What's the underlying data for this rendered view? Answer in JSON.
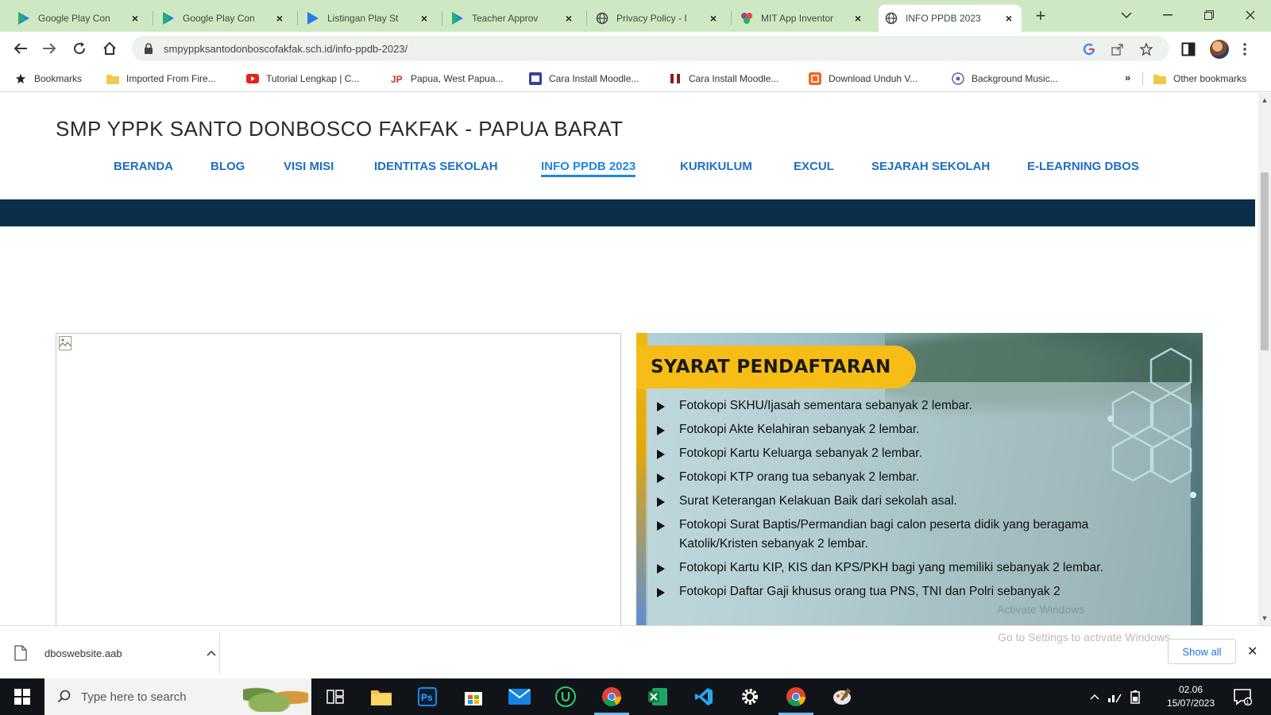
{
  "browser": {
    "tabs": [
      {
        "label": "Google Play Con",
        "icon": "google-play-icon",
        "active": false
      },
      {
        "label": "Google Play Con",
        "icon": "google-play-icon",
        "active": false
      },
      {
        "label": "Listingan Play St",
        "icon": "google-play-icon",
        "active": false
      },
      {
        "label": "Teacher Approv",
        "icon": "google-play-icon",
        "active": false
      },
      {
        "label": "Privacy Policy - I",
        "icon": "globe-icon",
        "active": false
      },
      {
        "label": "MIT App Inventor",
        "icon": "mit-app-inventor-icon",
        "active": false
      },
      {
        "label": "INFO PPDB 2023",
        "icon": "globe-icon",
        "active": true
      }
    ],
    "url": "smpyppksantodonboscofakfak.sch.id/info-ppdb-2023/",
    "bookmarks": [
      {
        "label": "Bookmarks",
        "icon": "star-icon"
      },
      {
        "label": "Imported From Fire...",
        "icon": "folder-icon"
      },
      {
        "label": "Tutorial Lengkap | C...",
        "icon": "youtube-icon"
      },
      {
        "label": "Papua, West Papua...",
        "icon": "jp-icon"
      },
      {
        "label": "Cara Install Moodle...",
        "icon": "moodle-icon"
      },
      {
        "label": "Cara Install Moodle...",
        "icon": "moodle-icon"
      },
      {
        "label": "Download Unduh V...",
        "icon": "download-site-icon"
      },
      {
        "label": "Background Music...",
        "icon": "music-icon"
      }
    ],
    "other_bookmarks": "Other bookmarks",
    "more_bookmarks": "»"
  },
  "site": {
    "title": "SMP YPPK SANTO DONBOSCO FAKFAK - PAPUA BARAT",
    "nav": [
      {
        "label": "BERANDA",
        "active": false
      },
      {
        "label": "BLOG",
        "active": false
      },
      {
        "label": "VISI MISI",
        "active": false
      },
      {
        "label": "IDENTITAS SEKOLAH",
        "active": false
      },
      {
        "label": "INFO PPDB 2023",
        "active": true
      },
      {
        "label": "KURIKULUM",
        "active": false
      },
      {
        "label": "EXCUL",
        "active": false
      },
      {
        "label": "SEJARAH SEKOLAH",
        "active": false
      },
      {
        "label": "E-LEARNING DBOS",
        "active": false
      }
    ]
  },
  "flyer": {
    "heading": "SYARAT PENDAFTARAN",
    "items": [
      "Fotokopi SKHU/Ijasah sementara sebanyak 2 lembar.",
      "Fotokopi Akte Kelahiran sebanyak 2 lembar.",
      "Fotokopi Kartu Keluarga sebanyak 2 lembar.",
      "Fotokopi KTP orang tua sebanyak 2 lembar.",
      "Surat Keterangan Kelakuan Baik dari sekolah asal.",
      "Fotokopi Surat Baptis/Permandian bagi calon peserta didik yang beragama Katolik/Kristen sebanyak 2 lembar.",
      "Fotokopi Kartu KIP, KIS dan KPS/PKH bagi yang memiliki sebanyak 2 lembar.",
      "Fotokopi Daftar Gaji khusus orang tua PNS, TNI dan Polri sebanyak 2"
    ]
  },
  "windows_watermark": {
    "line1": "Activate Windows",
    "line2": "Go to Settings to activate Windows."
  },
  "download_shelf": {
    "file_name": "dboswebsite.aab",
    "show_all": "Show all"
  },
  "taskbar": {
    "search_placeholder": "Type here to search",
    "apps": [
      "task-view-icon",
      "file-explorer-icon",
      "photoshop-icon",
      "microsoft-store-icon",
      "mail-icon",
      "app-u-icon",
      "chrome-icon",
      "excel-icon",
      "vscode-icon",
      "settings-icon",
      "chrome-icon",
      "paint-icon"
    ],
    "clock_time": "02.06",
    "clock_date": "15/07/2023"
  },
  "colors": {
    "tabstrip": "#cfe8c4",
    "nav_link": "#1e6fc0",
    "header_band": "#0b2e4a",
    "flyer_heading_bg": "#f6bd16"
  }
}
